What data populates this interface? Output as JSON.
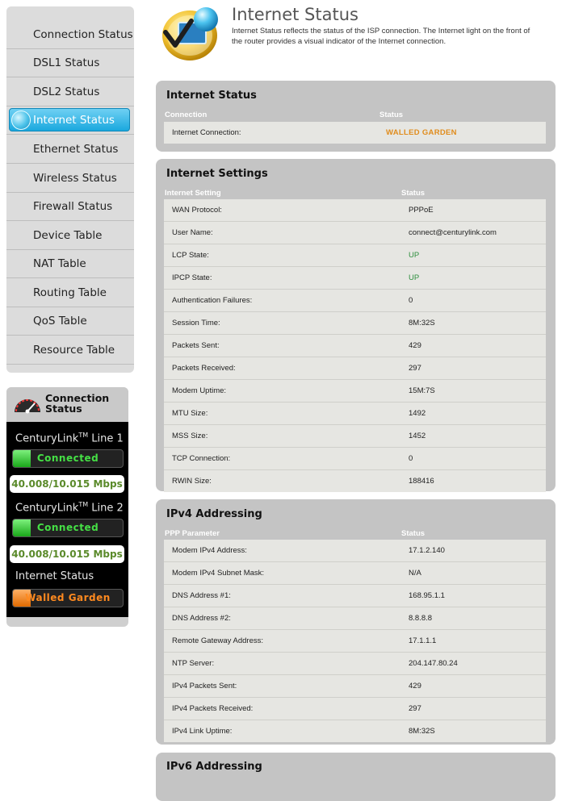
{
  "nav": {
    "items": [
      {
        "label": "Connection Status",
        "active": false
      },
      {
        "label": "DSL1 Status",
        "active": false
      },
      {
        "label": "DSL2 Status",
        "active": false
      },
      {
        "label": "Internet Status",
        "active": true
      },
      {
        "label": "Ethernet Status",
        "active": false
      },
      {
        "label": "Wireless Status",
        "active": false
      },
      {
        "label": "Firewall Status",
        "active": false
      },
      {
        "label": "Device Table",
        "active": false
      },
      {
        "label": "NAT Table",
        "active": false
      },
      {
        "label": "Routing Table",
        "active": false
      },
      {
        "label": "QoS Table",
        "active": false
      },
      {
        "label": "Resource Table",
        "active": false
      }
    ]
  },
  "conn_widget": {
    "title": "Connection Status",
    "gauge_icon": "speedometer-icon",
    "line1": {
      "brand": "CenturyLink",
      "tm": "TM",
      "suffix": "Line 1",
      "status": "Connected",
      "speed": "40.008/10.015 Mbps"
    },
    "line2": {
      "brand": "CenturyLink",
      "tm": "TM",
      "suffix": "Line 2",
      "status": "Connected",
      "speed": "40.008/10.015 Mbps"
    },
    "internet": {
      "label": "Internet Status",
      "status": "Walled Garden"
    },
    "colors": {
      "connected": "#45e045",
      "walled": "#ff8a1f"
    }
  },
  "header": {
    "icon": "internet-check-icon",
    "title": "Internet Status",
    "description": "Internet Status reflects the status of the ISP connection. The Internet light on the front of the router provides a visual indicator of the Internet connection."
  },
  "internet_status": {
    "title": "Internet Status",
    "col1": "Connection",
    "col2": "Status",
    "rows": [
      {
        "k": "Internet Connection:",
        "v": "WALLED GARDEN"
      }
    ]
  },
  "internet_settings": {
    "title": "Internet Settings",
    "col1": "Internet Setting",
    "col2": "Status",
    "rows": [
      {
        "k": "WAN Protocol:",
        "v": "PPPoE"
      },
      {
        "k": "User Name:",
        "v": "connect@centurylink.com"
      },
      {
        "k": "LCP State:",
        "v": "UP"
      },
      {
        "k": "IPCP State:",
        "v": "UP"
      },
      {
        "k": "Authentication Failures:",
        "v": "0"
      },
      {
        "k": "Session Time:",
        "v": "8M:32S"
      },
      {
        "k": "Packets Sent:",
        "v": "429"
      },
      {
        "k": "Packets Received:",
        "v": "297"
      },
      {
        "k": "Modem Uptime:",
        "v": "15M:7S"
      },
      {
        "k": "MTU Size:",
        "v": "1492"
      },
      {
        "k": "MSS Size:",
        "v": "1452"
      },
      {
        "k": "TCP Connection:",
        "v": "0"
      },
      {
        "k": "RWIN Size:",
        "v": "188416"
      }
    ]
  },
  "ipv4": {
    "title": "IPv4 Addressing",
    "col1": "PPP Parameter",
    "col2": "Status",
    "rows": [
      {
        "k": "Modem IPv4 Address:",
        "v": "17.1.2.140"
      },
      {
        "k": "Modem IPv4 Subnet Mask:",
        "v": "N/A"
      },
      {
        "k": "DNS Address #1:",
        "v": "168.95.1.1"
      },
      {
        "k": "DNS Address #2:",
        "v": "8.8.8.8"
      },
      {
        "k": "Remote Gateway Address:",
        "v": "17.1.1.1"
      },
      {
        "k": "NTP Server:",
        "v": "204.147.80.24"
      },
      {
        "k": "IPv4 Packets Sent:",
        "v": "429"
      },
      {
        "k": "IPv4 Packets Received:",
        "v": "297"
      },
      {
        "k": "IPv4 Link Uptime:",
        "v": "8M:32S"
      }
    ]
  },
  "ipv6": {
    "title": "IPv6 Addressing"
  },
  "colors": {
    "up": "#2f8f3f",
    "walled_garden": "#e08c1c",
    "active_nav": "#1aa8de"
  }
}
